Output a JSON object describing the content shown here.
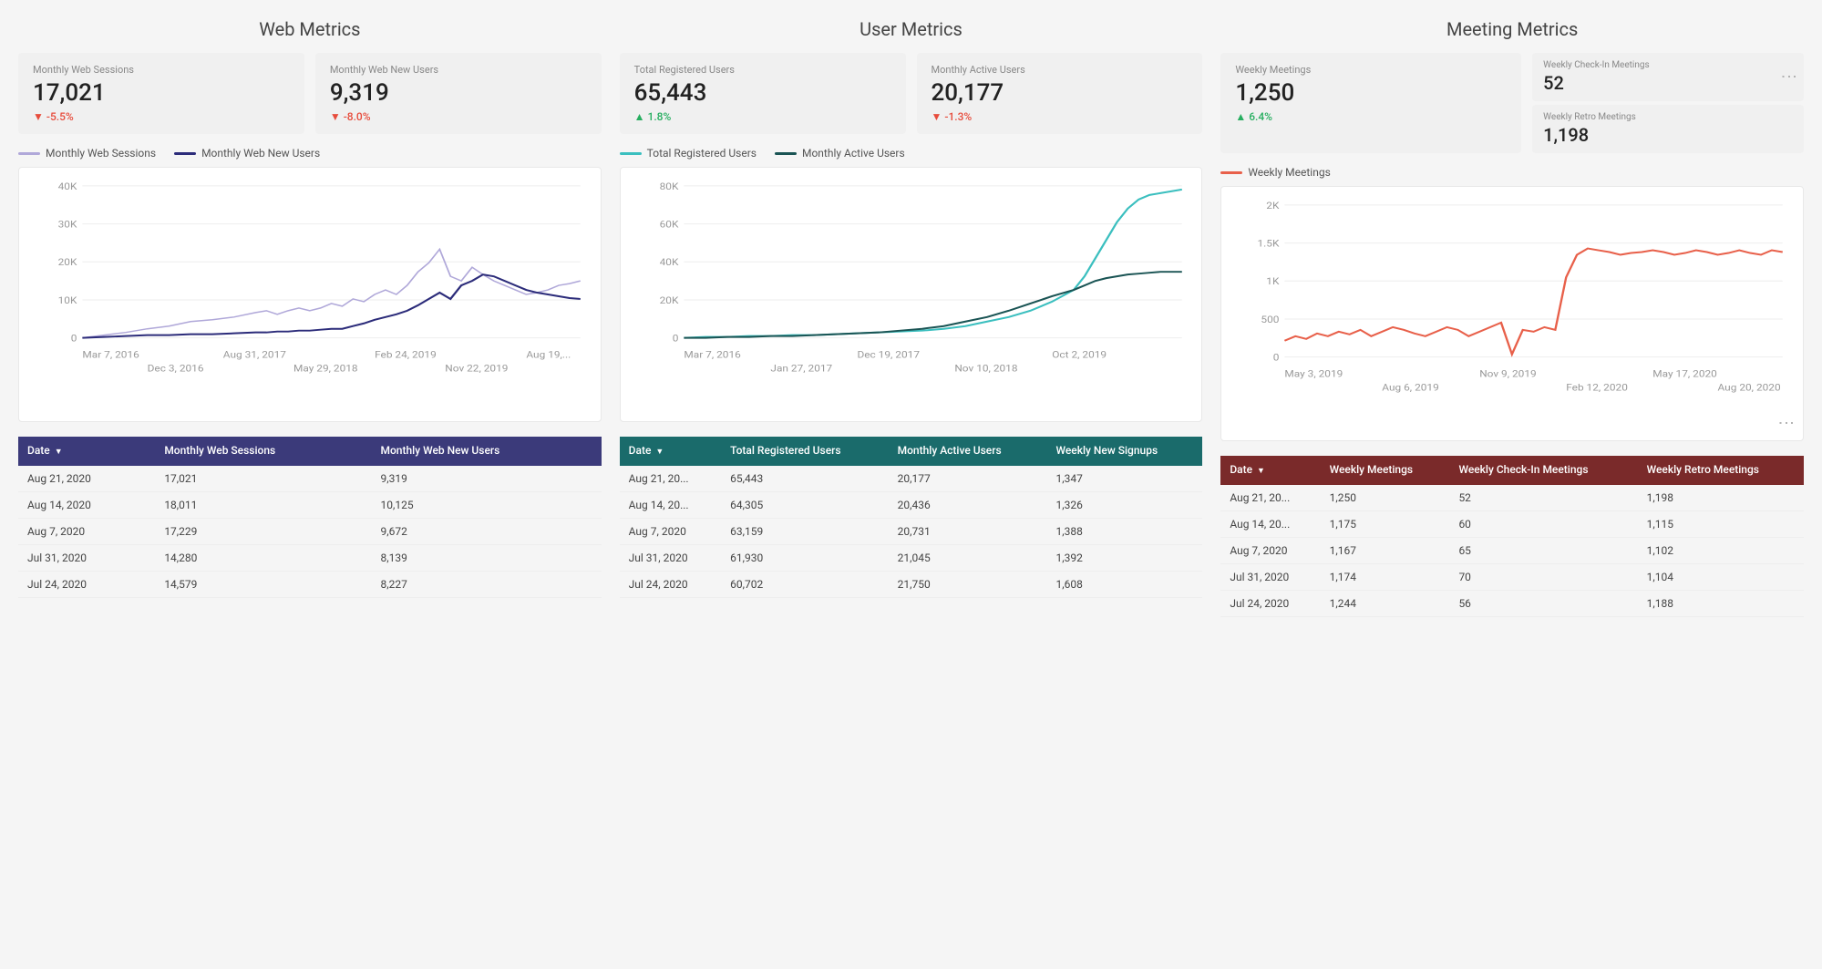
{
  "sections": {
    "web": {
      "title": "Web Metrics",
      "kpis": [
        {
          "label": "Monthly Web Sessions",
          "value": "17,021",
          "change": "-5.5%",
          "direction": "negative"
        },
        {
          "label": "Monthly Web New Users",
          "value": "9,319",
          "change": "-8.0%",
          "direction": "negative"
        }
      ],
      "legend": [
        {
          "label": "Monthly Web Sessions",
          "color": "#b0a8d9"
        },
        {
          "label": "Monthly Web New Users",
          "color": "#2c2c7a"
        }
      ],
      "chart": {
        "yLabels": [
          "40K",
          "30K",
          "20K",
          "10K",
          "0"
        ],
        "xLabels": [
          "Mar 7, 2016",
          "Aug 31, 2017",
          "Feb 24, 2019",
          "Aug 19,..."
        ],
        "xLabels2": [
          "Dec 3, 2016",
          "May 29, 2018",
          "Nov 22, 2019"
        ]
      },
      "table": {
        "headers": [
          "Date",
          "Monthly Web Sessions",
          "Monthly Web New Users"
        ],
        "rows": [
          [
            "Aug 21, 2020",
            "17,021",
            "9,319"
          ],
          [
            "Aug 14, 2020",
            "18,011",
            "10,125"
          ],
          [
            "Aug 7, 2020",
            "17,229",
            "9,672"
          ],
          [
            "Jul 31, 2020",
            "14,280",
            "8,139"
          ],
          [
            "Jul 24, 2020",
            "14,579",
            "8,227"
          ]
        ]
      }
    },
    "user": {
      "title": "User Metrics",
      "kpis": [
        {
          "label": "Total Registered Users",
          "value": "65,443",
          "change": "1.8%",
          "direction": "positive"
        },
        {
          "label": "Monthly Active Users",
          "value": "20,177",
          "change": "-1.3%",
          "direction": "negative"
        }
      ],
      "legend": [
        {
          "label": "Total Registered Users",
          "color": "#3bbfbf"
        },
        {
          "label": "Monthly Active Users",
          "color": "#1a5454"
        }
      ],
      "chart": {
        "yLabels": [
          "80K",
          "60K",
          "40K",
          "20K",
          "0"
        ],
        "xLabels": [
          "Mar 7, 2016",
          "Dec 19, 2017",
          "Oct 2, 2019"
        ],
        "xLabels2": [
          "Jan 27, 2017",
          "Nov 10, 2018"
        ]
      },
      "table": {
        "headers": [
          "Date",
          "Total Registered Users",
          "Monthly Active Users",
          "Weekly New Signups"
        ],
        "rows": [
          [
            "Aug 21, 20...",
            "65,443",
            "20,177",
            "1,347"
          ],
          [
            "Aug 14, 20...",
            "64,305",
            "20,436",
            "1,326"
          ],
          [
            "Aug 7, 2020",
            "63,159",
            "20,731",
            "1,388"
          ],
          [
            "Jul 31, 2020",
            "61,930",
            "21,045",
            "1,392"
          ],
          [
            "Jul 24, 2020",
            "60,702",
            "21,750",
            "1,608"
          ]
        ]
      }
    },
    "meeting": {
      "title": "Meeting Metrics",
      "kpi_main": {
        "label": "Weekly Meetings",
        "value": "1,250",
        "change": "6.4%",
        "direction": "positive"
      },
      "kpi_side": [
        {
          "label": "Weekly Check-In Meetings",
          "value": "52"
        },
        {
          "label": "Weekly Retro Meetings",
          "value": "1,198"
        }
      ],
      "legend": [
        {
          "label": "Weekly Meetings",
          "color": "#e8604a"
        }
      ],
      "chart": {
        "yLabels": [
          "2K",
          "1.5K",
          "1K",
          "500",
          "0"
        ],
        "xLabels": [
          "May 3, 2019",
          "Nov 9, 2019",
          "May 17, 2020"
        ],
        "xLabels2": [
          "Aug 6, 2019",
          "Feb 12, 2020",
          "Aug 20, 2020"
        ]
      },
      "table": {
        "headers": [
          "Date",
          "Weekly Meetings",
          "Weekly Check-In Meetings",
          "Weekly Retro Meetings"
        ],
        "rows": [
          [
            "Aug 21, 20...",
            "1,250",
            "52",
            "1,198"
          ],
          [
            "Aug 14, 20...",
            "1,175",
            "60",
            "1,115"
          ],
          [
            "Aug 7, 2020",
            "1,167",
            "65",
            "1,102"
          ],
          [
            "Jul 31, 2020",
            "1,174",
            "70",
            "1,104"
          ],
          [
            "Jul 24, 2020",
            "1,244",
            "56",
            "1,188"
          ]
        ]
      }
    }
  }
}
